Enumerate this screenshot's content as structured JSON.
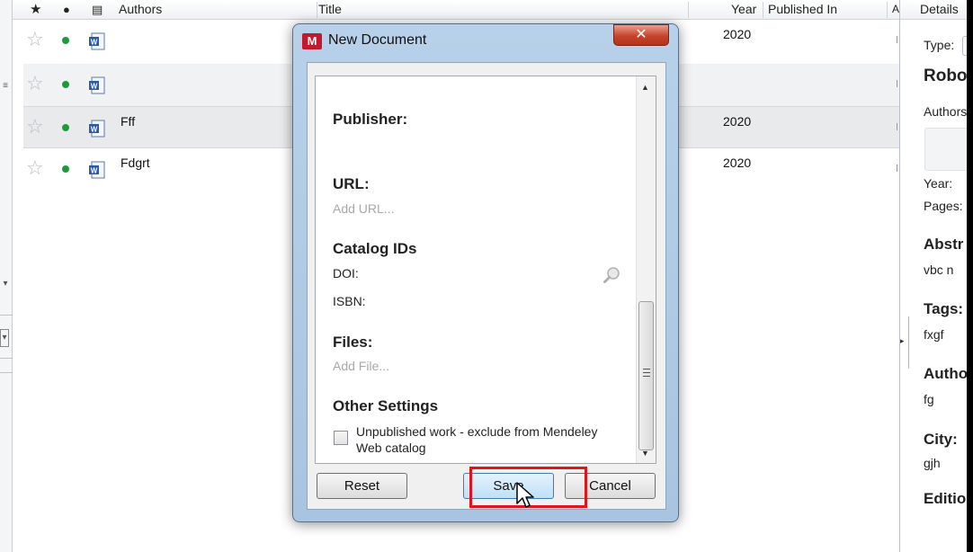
{
  "table": {
    "columns": {
      "authors": "Authors",
      "title": "Title",
      "year": "Year",
      "published_in": "Published In",
      "cut": "A"
    },
    "rows": [
      {
        "author": "",
        "year": "2020"
      },
      {
        "author": "",
        "year": ""
      },
      {
        "author": "Fff",
        "year": "2020"
      },
      {
        "author": "Fdgrt",
        "year": "2020"
      }
    ]
  },
  "details": {
    "tab": "Details",
    "type_label": "Type:",
    "title": "Robo",
    "authors_label": "Authors",
    "year_label": "Year:",
    "pages_label": "Pages:",
    "abstract_label": "Abstr",
    "abstract_value": "vbc n",
    "tags_label": "Tags:",
    "tags_value": "fxgf",
    "author_keywords_label": "Autho",
    "author_keywords_value": "fg",
    "city_label": "City:",
    "city_value": "gjh",
    "edition_label": "Editio"
  },
  "dialog": {
    "title": "New Document",
    "close": "✕",
    "sections": {
      "publisher_label": "Publisher:",
      "url_label": "URL:",
      "url_placeholder": "Add URL...",
      "catalog_label": "Catalog IDs",
      "doi_label": "DOI:",
      "isbn_label": "ISBN:",
      "files_label": "Files:",
      "files_placeholder": "Add File...",
      "other_label": "Other Settings",
      "unpublished_text": "Unpublished work - exclude from Mendeley Web catalog"
    },
    "buttons": {
      "reset": "Reset",
      "save": "Save",
      "cancel": "Cancel"
    }
  },
  "colors": {
    "accent": "#c4182c",
    "highlight": "#e0151b",
    "read_dot": "#1f9a3a"
  }
}
